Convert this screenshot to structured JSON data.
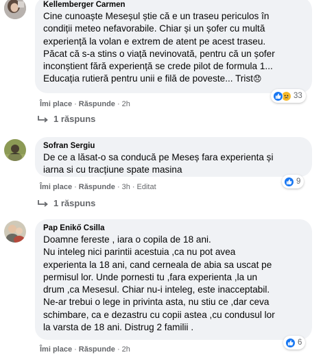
{
  "comments": [
    {
      "author": "Kellemberger Carmen",
      "text": "Cine cunoaște Meseșul știe că e un traseu periculos în\ncondiții meteo nefavorabile. Chiar și un șofer cu multă\nexperiență la volan e extrem de atent pe acest traseu.\nPăcat că s-a stins o viață nevinovată, pentru că un șofer\ninconștient fără experiență se crede pilot de formula 1...\nEducația rutieră pentru unii e filă de poveste... Trist",
      "emoji": "😞",
      "like": "Îmi place",
      "reply": "Răspunde",
      "time": "2h",
      "edited": "",
      "reactions_count": "33",
      "replies_label": "1 răspuns"
    },
    {
      "author": "Sofran Sergiu",
      "text": "De ce a lăsat-o sa conducă pe Meseș fara experienta și\niarna si cu tracțiune spate masina",
      "emoji": "",
      "like": "Îmi place",
      "reply": "Răspunde",
      "time": "3h",
      "edited": "Editat",
      "reactions_count": "9",
      "replies_label": "1 răspuns"
    },
    {
      "author": "Pap Enikő Csilla",
      "text": "Doamne fereste , iara o copila de 18 ani.\nNu inteleg nici parintii acestuia ,ca nu pot avea\nexperienta la 18 ani, cand cerneala de abia sa uscat pe\npermisul lor. Unde pornesti tu ,fara experienta ,la un\ndrum ,ca Mesesul. Chiar nu-i inteleg, este inacceptabil.\nNe-ar trebui o lege in privinta asta, nu stiu ce ,dar ceva\nschimbare, ca e dezastru cu copii astea ,cu condusul lor\nla varsta de 18 ani. Distrug 2 familii .",
      "emoji": "",
      "like": "Îmi place",
      "reply": "Răspunde",
      "time": "2h",
      "edited": "",
      "reactions_count": "6",
      "replies_label": ""
    }
  ],
  "colors": {
    "bubble": "#f0f2f5",
    "like_blue": "#1877f2",
    "sad_yellow": "#f7b928",
    "meta_gray": "#65676b"
  }
}
